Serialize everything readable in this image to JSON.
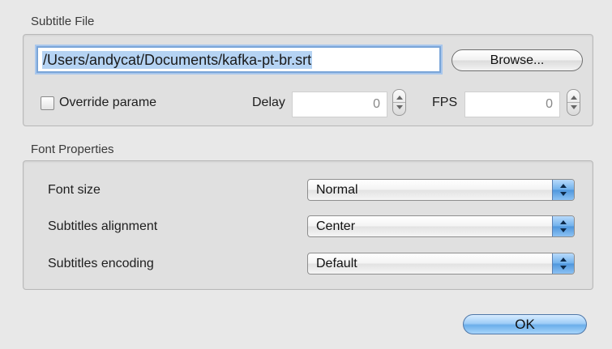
{
  "subtitle_file": {
    "section_title": "Subtitle File",
    "path_value": "/Users/andycat/Documents/kafka-pt-br.srt",
    "browse_label": "Browse...",
    "override_label": "Override parame",
    "override_checked": false,
    "delay_label": "Delay",
    "delay_value": "0",
    "fps_label": "FPS",
    "fps_value": "0"
  },
  "font_properties": {
    "section_title": "Font Properties",
    "rows": [
      {
        "label": "Font size",
        "selected": "Normal"
      },
      {
        "label": "Subtitles alignment",
        "selected": "Center"
      },
      {
        "label": "Subtitles encoding",
        "selected": "Default"
      }
    ]
  },
  "footer": {
    "ok_label": "OK"
  },
  "colors": {
    "accent": "#6aaeea",
    "selection": "#b5d3f3",
    "window_bg": "#e8e8e8"
  }
}
